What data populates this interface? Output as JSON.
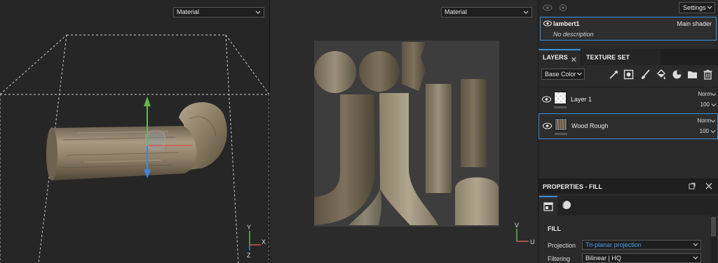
{
  "viewport3d": {
    "mode": "Material",
    "axis_x": "X",
    "axis_y": "Y",
    "axis_z": "Z"
  },
  "viewport2d": {
    "mode": "Material",
    "axis_u": "U",
    "axis_v": "V"
  },
  "topbar": {
    "settings_label": "Settings"
  },
  "shader": {
    "name": "lambert1",
    "role": "Main shader",
    "description": "No description"
  },
  "tabs": {
    "layers": "LAYERS",
    "layers_close": "✕",
    "texture_set_settings": "TEXTURE SET SETTINGS"
  },
  "toolbar": {
    "channel": "Base Color"
  },
  "layers": [
    {
      "name": "Layer 1",
      "blend": "Norm",
      "opacity": "100"
    },
    {
      "name": "Wood Rough",
      "blend": "Norm",
      "opacity": "100"
    }
  ],
  "properties": {
    "title": "PROPERTIES - FILL",
    "section": "FILL",
    "projection_label": "Projection",
    "projection_value": "Tri-planar projection",
    "filtering_label": "Filtering",
    "filtering_value": "Bilinear | HQ"
  },
  "colors": {
    "accent": "#3a8fd8",
    "projection_text": "#4a9ef0",
    "viewport_bg": "#262626",
    "wood": "#8a7a62"
  },
  "icons": [
    "eye-icon",
    "visibility-icon",
    "chevron-down-icon",
    "magic-wand-icon",
    "add-mask-icon",
    "paint-brush-icon",
    "fill-icon",
    "smart-material-icon",
    "folder-icon",
    "trash-icon",
    "fill-properties-icon",
    "material-ball-icon",
    "detach-icon",
    "close-icon"
  ]
}
